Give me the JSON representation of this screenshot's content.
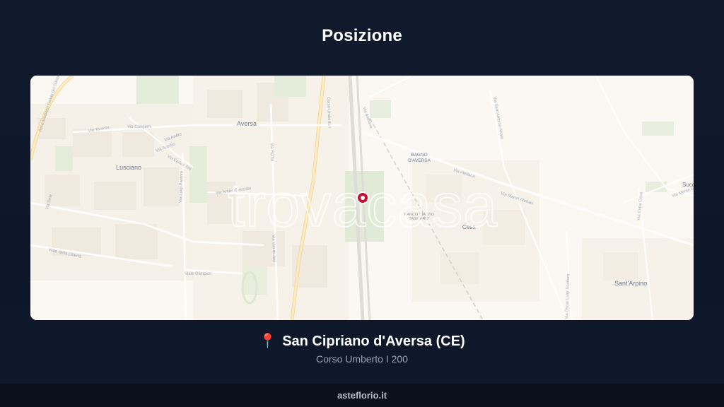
{
  "title": "Posizione",
  "map": {
    "watermark": "trovacasa",
    "labels": {
      "aversa": "Aversa",
      "lusciano": "Lusciano",
      "bagno1": "BAGNO",
      "bagno2": "D'AVERSA",
      "cesa": "Cesa",
      "sant_arpino": "Sant'Arpino",
      "succ": "Succ",
      "parco1": "PARCO \"SALVIO",
      "parco2": "TAGLIERO\""
    },
    "streets": {
      "via_atellana": "Via Atellana",
      "via_martiri": "Via Martiri Atellani",
      "viale_liberta": "Viale della Libertà",
      "viale_olimpico": "Viale Olimpico",
      "via_roma": "Via Roma",
      "via_vito": "Via Vito di Jasi",
      "via_luigi": "Via Luigi Pastore",
      "via_cangemi": "Via Cangemi",
      "via_taranto": "Via Taranto",
      "via_acerbo": "Via Acerbo",
      "via_ardito": "Via Ardito",
      "via_enrico": "Via Enrico Toti",
      "via_arturo": "Via Arturo Garofalo",
      "via_umberto": "Corso Umberto I",
      "via_sant_antonio": "Via Sant'Antonio Abate",
      "via_cupa": "Via Cupa Cesa",
      "via_oscar": "Via Oscar Luigi Scalfaro",
      "via_monte": "Via Monte Grappa",
      "via_sele": "Via Sele",
      "asse": "Asse Mediano Fondo del Sasso"
    }
  },
  "location": {
    "pin_icon": "📍",
    "place": "San Cipriano d'Aversa (CE)",
    "address": "Corso Umberto I 200",
    "marker_color": "#c8102e"
  },
  "footer": "asteflorio.it"
}
